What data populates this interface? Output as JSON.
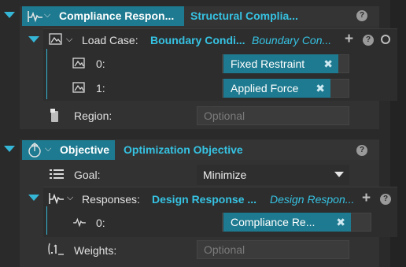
{
  "compliance": {
    "title": "Compliance Respon...",
    "ref": "Structural Complia...",
    "help": "?",
    "load_case": {
      "label": "Load Case:",
      "ref_bold": "Boundary Condi...",
      "ref_italic": "Boundary Con...",
      "items": [
        {
          "index": "0:",
          "value": "Fixed Restraint"
        },
        {
          "index": "1:",
          "value": "Applied Force"
        }
      ],
      "add": "+",
      "help": "?"
    },
    "region": {
      "label": "Region:",
      "placeholder": "Optional"
    }
  },
  "objective": {
    "title": "Objective",
    "ref": "Optimization Objective",
    "help": "?",
    "goal": {
      "label": "Goal:",
      "value": "Minimize"
    },
    "responses": {
      "label": "Responses:",
      "ref_bold": "Design Response ...",
      "ref_italic": "Design Respon...",
      "items": [
        {
          "index": "0:",
          "value": "Compliance Re..."
        }
      ],
      "add": "+",
      "help": "?"
    },
    "weights": {
      "label": "Weights:",
      "placeholder": "Optional"
    }
  },
  "icons": {
    "expand": "triangle-down",
    "collapse_chevron": "chevron-down",
    "remove": "close-x",
    "dropdown": "caret-down"
  },
  "colors": {
    "accent": "#36c2e2",
    "header_bg": "#1e7a90",
    "background": "#2a2a2a"
  }
}
